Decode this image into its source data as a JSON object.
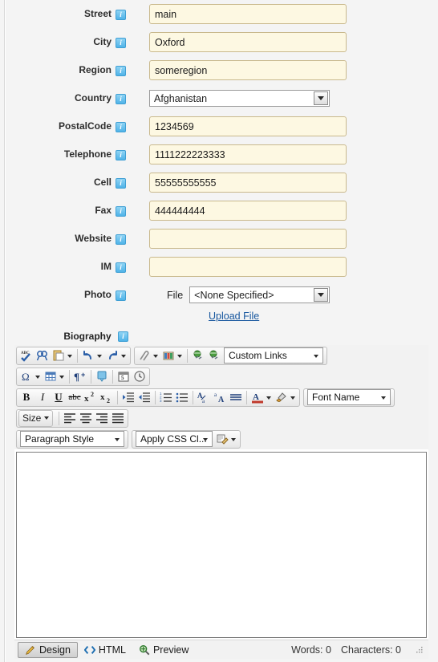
{
  "form": {
    "fields": [
      {
        "label": "Street",
        "icon": "info-icon",
        "type": "text",
        "value": "main",
        "placeholder": ""
      },
      {
        "label": "City",
        "icon": "info-icon",
        "type": "text",
        "value": "Oxford",
        "placeholder": ""
      },
      {
        "label": "Region",
        "icon": "info-icon",
        "type": "text",
        "value": "someregion",
        "placeholder": ""
      },
      {
        "label": "Country",
        "icon": "info-icon",
        "type": "select",
        "value": "Afghanistan",
        "placeholder": ""
      },
      {
        "label": "PostalCode",
        "icon": "info-icon",
        "type": "text",
        "value": "1234569",
        "placeholder": ""
      },
      {
        "label": "Telephone",
        "icon": "info-icon",
        "type": "text",
        "value": "1111222223333",
        "placeholder": ""
      },
      {
        "label": "Cell",
        "icon": "info-icon",
        "type": "text",
        "value": "55555555555",
        "placeholder": ""
      },
      {
        "label": "Fax",
        "icon": "info-icon",
        "type": "text",
        "value": "444444444",
        "placeholder": ""
      },
      {
        "label": "Website",
        "icon": "info-icon",
        "type": "text",
        "value": "",
        "placeholder": ""
      },
      {
        "label": "IM",
        "icon": "info-icon",
        "type": "text",
        "value": "",
        "placeholder": ""
      }
    ],
    "photo": {
      "label": "Photo",
      "file_label": "File",
      "file_value": "<None Specified>",
      "upload_link": "Upload File"
    },
    "biography_label": "Biography"
  },
  "editor": {
    "toolbar_rows": [
      {
        "groups": [
          {
            "items": [
              {
                "name": "spellcheck-icon",
                "kind": "icon"
              },
              {
                "name": "find-replace-icon",
                "kind": "icon"
              },
              {
                "name": "paste-icon",
                "kind": "icon",
                "split": true
              },
              {
                "name": "separator",
                "kind": "sep"
              },
              {
                "name": "undo-icon",
                "kind": "icon",
                "split": true
              },
              {
                "name": "redo-icon",
                "kind": "icon",
                "split": true
              }
            ]
          },
          {
            "items": [
              {
                "name": "insert-link-icon",
                "kind": "icon",
                "split": true
              },
              {
                "name": "insert-image-icon",
                "kind": "icon",
                "split": true
              },
              {
                "name": "separator",
                "kind": "sep"
              },
              {
                "name": "hyperlink-icon",
                "kind": "icon"
              },
              {
                "name": "remove-hyperlink-icon",
                "kind": "icon"
              },
              {
                "name": "custom-links-dropdown",
                "kind": "dropdown",
                "label": "Custom Links",
                "width": 124
              }
            ]
          }
        ]
      },
      {
        "groups": [
          {
            "items": [
              {
                "name": "special-character-icon",
                "kind": "icon",
                "split": true
              },
              {
                "name": "insert-table-icon",
                "kind": "icon",
                "split": true
              },
              {
                "name": "separator",
                "kind": "sep"
              },
              {
                "name": "paragraph-insert-icon",
                "kind": "icon"
              },
              {
                "name": "separator",
                "kind": "sep"
              },
              {
                "name": "insert-snippet-icon",
                "kind": "icon"
              },
              {
                "name": "separator",
                "kind": "sep"
              },
              {
                "name": "insert-date-icon",
                "kind": "icon"
              },
              {
                "name": "insert-time-icon",
                "kind": "icon"
              }
            ]
          }
        ]
      },
      {
        "groups": [
          {
            "items": [
              {
                "name": "bold-button",
                "kind": "text",
                "label": "B",
                "style": "bold"
              },
              {
                "name": "italic-button",
                "kind": "text",
                "label": "I",
                "style": "italic"
              },
              {
                "name": "underline-button",
                "kind": "text",
                "label": "U",
                "style": "underline"
              },
              {
                "name": "strikethrough-button",
                "kind": "text",
                "label": "abc",
                "style": "strike"
              },
              {
                "name": "superscript-button",
                "kind": "icon"
              },
              {
                "name": "subscript-button",
                "kind": "icon"
              },
              {
                "name": "separator",
                "kind": "sep"
              },
              {
                "name": "indent-icon",
                "kind": "icon"
              },
              {
                "name": "outdent-icon",
                "kind": "icon"
              },
              {
                "name": "separator",
                "kind": "sep"
              },
              {
                "name": "ordered-list-icon",
                "kind": "icon"
              },
              {
                "name": "unordered-list-icon",
                "kind": "icon"
              },
              {
                "name": "separator",
                "kind": "sep"
              },
              {
                "name": "remove-formatting-icon",
                "kind": "icon"
              },
              {
                "name": "format-stripper-icon",
                "kind": "icon"
              },
              {
                "name": "horizontal-rule-icon",
                "kind": "icon"
              },
              {
                "name": "separator",
                "kind": "sep"
              },
              {
                "name": "font-color-icon",
                "kind": "icon",
                "split": true
              },
              {
                "name": "highlight-color-icon",
                "kind": "icon",
                "split": true
              }
            ]
          },
          {
            "items": [
              {
                "name": "font-name-dropdown",
                "kind": "dropdown",
                "label": "Font Name",
                "width": 104
              }
            ]
          }
        ]
      },
      {
        "groups": [
          {
            "items": [
              {
                "name": "font-size-button",
                "kind": "textbtn",
                "label": "Size"
              },
              {
                "name": "separator",
                "kind": "sep"
              },
              {
                "name": "align-left-icon",
                "kind": "icon"
              },
              {
                "name": "align-center-icon",
                "kind": "icon"
              },
              {
                "name": "align-right-icon",
                "kind": "icon"
              },
              {
                "name": "align-justify-icon",
                "kind": "icon"
              }
            ]
          }
        ]
      },
      {
        "groups": [
          {
            "items": [
              {
                "name": "paragraph-style-dropdown",
                "kind": "dropdown",
                "label": "Paragraph Style",
                "width": 130
              }
            ]
          },
          {
            "items": [
              {
                "name": "apply-css-class-dropdown",
                "kind": "dropdown",
                "label": "Apply CSS Cl...",
                "width": 96
              },
              {
                "name": "format-painter-icon",
                "kind": "icon",
                "split": true
              }
            ]
          }
        ]
      }
    ],
    "content": "",
    "statusbar": {
      "tabs": [
        {
          "label": "Design",
          "icon": "pencil-icon",
          "active": true
        },
        {
          "label": "HTML",
          "icon": "code-icon",
          "active": false
        },
        {
          "label": "Preview",
          "icon": "magnifier-icon",
          "active": false
        }
      ],
      "words": "Words: 0",
      "characters": "Characters: 0"
    }
  },
  "colors": {
    "page_bg": "#f4f4f4",
    "field_bg": "#fdf8e2",
    "field_border": "#c9b98d",
    "link": "#16569e",
    "info_badge": "#4fb3e8"
  }
}
